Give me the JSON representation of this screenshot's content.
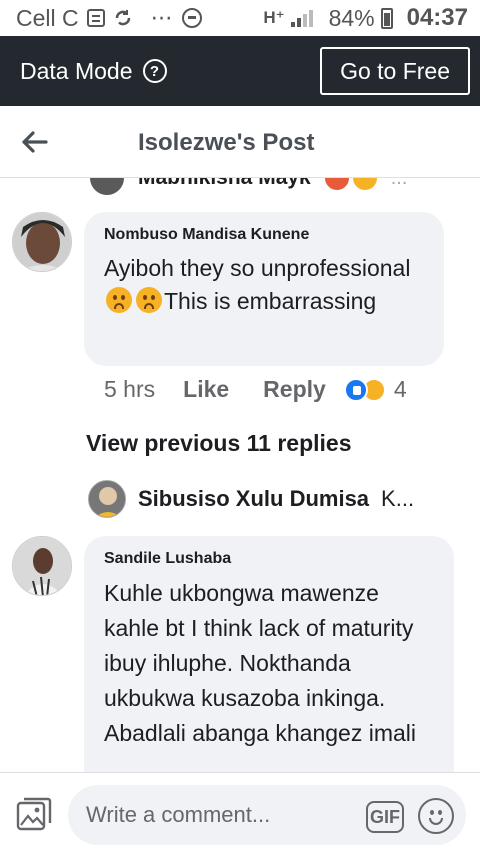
{
  "status_bar": {
    "carrier": "Cell C",
    "network": "H⁺",
    "battery": "84%",
    "time": "04:37"
  },
  "data_bar": {
    "label": "Data Mode",
    "help": "?",
    "button": "Go to Free"
  },
  "header": {
    "title": "Isolezwe's Post"
  },
  "partial_comment": {
    "name": "Mabhikisha Mayk",
    "more": "..."
  },
  "comments": [
    {
      "author": "Nombuso Mandisa Kunene",
      "text_part1": "Ayiboh they  so unprofessional ",
      "text_part2": "This is embarrassing",
      "time": "5 hrs",
      "like_label": "Like",
      "reply_label": "Reply",
      "reaction_count": "4"
    },
    {
      "author": "Sandile Lushaba",
      "text": "Kuhle ukbongwa mawenze kahle bt I think lack of maturity ibuy ihluphe. Nokthanda ukbukwa kusazoba inkinga. Abadlali abanga khangez imali"
    }
  ],
  "view_previous": "View previous 11 replies",
  "reply_preview": {
    "name": "Sibusiso Xulu Dumisa",
    "snippet": "K..."
  },
  "composer": {
    "placeholder": "Write a comment...",
    "gif_label": "GIF"
  },
  "colors": {
    "data_bar_bg": "#23292f",
    "bubble_bg": "#f0f2f5",
    "like_blue": "#1877f2"
  }
}
